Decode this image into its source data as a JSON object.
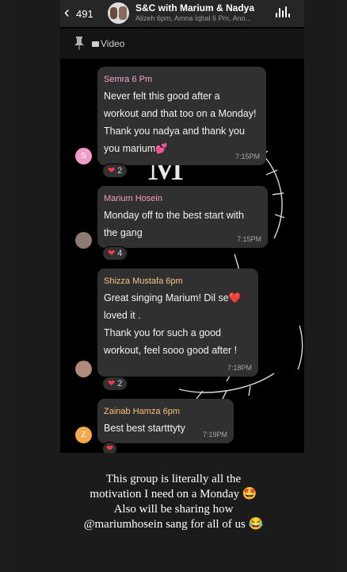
{
  "header": {
    "back_glyph": "‹",
    "unread_count": "491",
    "group_name": "S&C with Marium & Nadya",
    "members": "Alizeh 6pm, Amna Iqbal 6 Pm, Ano..."
  },
  "toolbar": {
    "video_label": "Video"
  },
  "background_letter": "M",
  "messages": [
    {
      "sender": "Semra 6 Pm",
      "sender_color": "#f5a8d0",
      "lines": [
        "Never felt this good after a",
        "workout and that too on a Monday!",
        "Thank you nadya and thank you",
        "you marium💕"
      ],
      "time": "7:15PM",
      "avatar_letter": "S",
      "avatar_color": "#f39bc4",
      "reaction_count": "2"
    },
    {
      "sender": "Marium Hosein",
      "sender_color": "#f2a0b4",
      "lines": [
        "Monday off to the best start with",
        "the gang"
      ],
      "time": "7:15PM",
      "avatar_letter": "",
      "reaction_count": "4"
    },
    {
      "sender": "Shizza Mustafa 6pm",
      "sender_color": "#f6c68a",
      "lines": [
        "Great singing Marium! Dil se❤️",
        "loved it .",
        "Thank you for such a good",
        "workout, feel sooo good after !"
      ],
      "time": "7:18PM",
      "avatar_letter": "",
      "reaction_count": "2"
    },
    {
      "sender": "Zainab Hamza 6pm",
      "sender_color": "#f7c07a",
      "lines": [
        "Best best startttyty"
      ],
      "time": "7:19PM",
      "avatar_letter": "Z",
      "avatar_color": "#f4a94a",
      "reaction_count": ""
    }
  ],
  "caption": {
    "line1": "This group is literally all the",
    "line2": "motivation I need on a Monday 🤩",
    "line3": "Also will be sharing how",
    "line4": "@mariumhosein sang for all of us 😂"
  },
  "colors": {
    "bubble": "#303030",
    "heart": "#ff3b47",
    "background": "#000000"
  }
}
